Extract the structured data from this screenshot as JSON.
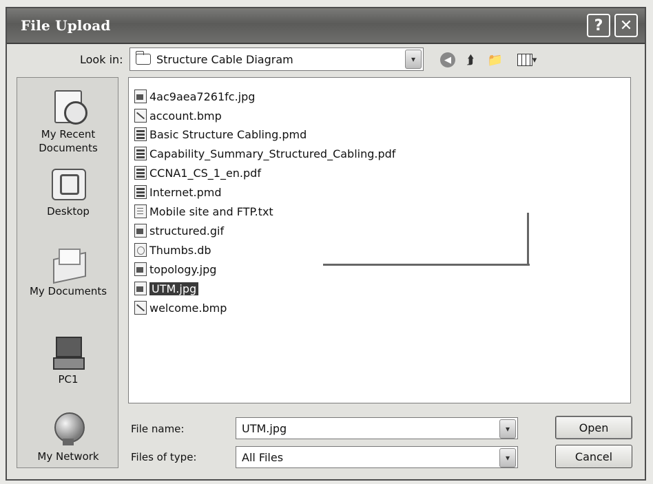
{
  "window": {
    "title": "File Upload",
    "help_label": "?",
    "close_label": "✕"
  },
  "lookin": {
    "label": "Look in:",
    "value": "Structure Cable Diagram",
    "dropdown": "▾"
  },
  "toolbar": {
    "back": "◀",
    "up": "⮭",
    "new_folder": "📁",
    "view_arrow": "▾"
  },
  "places": [
    {
      "label_1": "My Recent",
      "label_2": "Documents"
    },
    {
      "label_1": "Desktop"
    },
    {
      "label_1": "My Documents"
    },
    {
      "label_1": "PC1"
    },
    {
      "label_1": "My Network"
    }
  ],
  "files": [
    {
      "name": "4ac9aea7261fc.jpg",
      "kind": "img"
    },
    {
      "name": "account.bmp",
      "kind": "bmp"
    },
    {
      "name": "Basic Structure Cabling.pmd",
      "kind": "doc"
    },
    {
      "name": "Capability_Summary_Structured_Cabling.pdf",
      "kind": "doc"
    },
    {
      "name": "CCNA1_CS_1_en.pdf",
      "kind": "doc"
    },
    {
      "name": "Internet.pmd",
      "kind": "doc"
    },
    {
      "name": "Mobile site and FTP.txt",
      "kind": "txt"
    },
    {
      "name": "structured.gif",
      "kind": "img"
    },
    {
      "name": "Thumbs.db",
      "kind": "db"
    },
    {
      "name": "topology.jpg",
      "kind": "img"
    },
    {
      "name": "UTM.jpg",
      "kind": "img",
      "selected": true
    },
    {
      "name": "welcome.bmp",
      "kind": "bmp"
    }
  ],
  "form": {
    "file_name_label": "File name:",
    "file_name_value": "UTM.jpg",
    "file_type_label": "Files of type:",
    "file_type_value": "All Files",
    "dropdown": "▾"
  },
  "buttons": {
    "open": "Open",
    "cancel": "Cancel"
  }
}
